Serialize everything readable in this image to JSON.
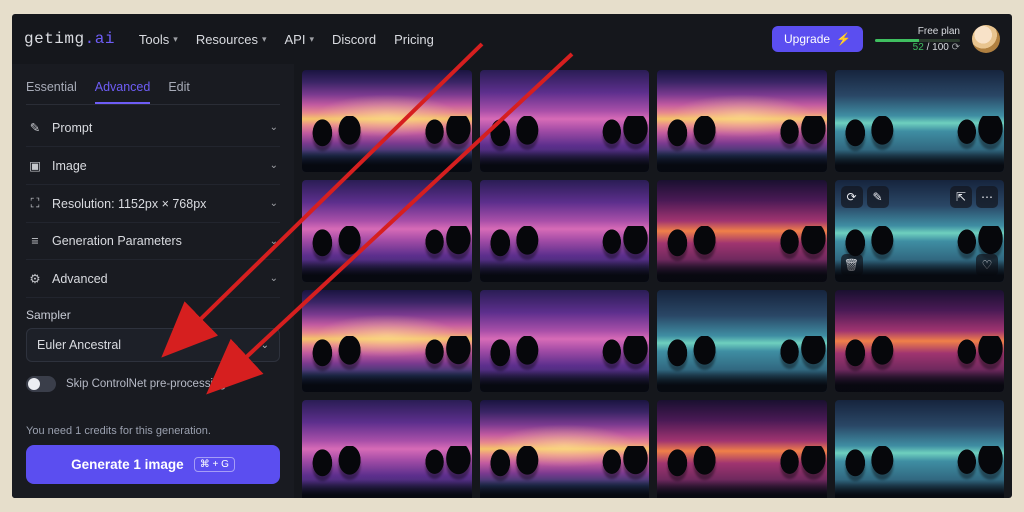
{
  "brand": {
    "name_a": "getimg",
    "dot": ".",
    "name_b": "ai"
  },
  "nav": {
    "tools": "Tools",
    "resources": "Resources",
    "api": "API",
    "discord": "Discord",
    "pricing": "Pricing"
  },
  "header": {
    "upgrade": "Upgrade",
    "plan_label": "Free plan",
    "credits_used": "52",
    "credits_sep": " / ",
    "credits_total": "100"
  },
  "tabs": {
    "essential": "Essential",
    "advanced": "Advanced",
    "edit": "Edit"
  },
  "acc": {
    "prompt": "Prompt",
    "image": "Image",
    "resolution": "Resolution: 1152px × 768px",
    "genparams": "Generation Parameters",
    "advanced": "Advanced"
  },
  "sampler": {
    "label": "Sampler",
    "value": "Euler Ancestral"
  },
  "toggle": {
    "skip_controlnet": "Skip ControlNet pre-processing"
  },
  "footer": {
    "credits_note": "You need 1 credits for this generation.",
    "generate": "Generate 1 image",
    "shortcut": "⌘ + G"
  },
  "colors": {
    "accent": "#5b4ef0",
    "accent_hover": "#6e5df6",
    "success": "#3fbf60"
  }
}
